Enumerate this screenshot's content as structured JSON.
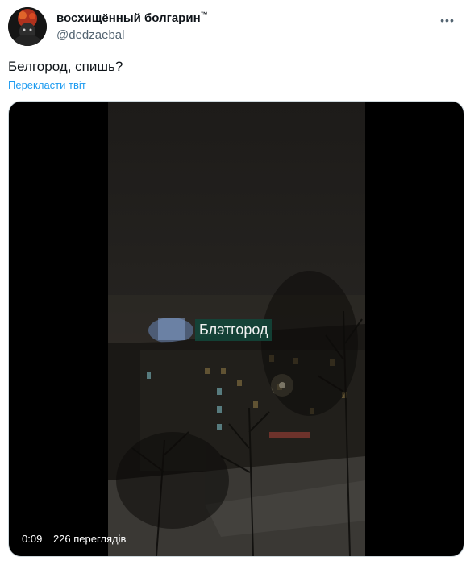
{
  "author": {
    "display_name": "восхищённый болгарин",
    "display_name_mark": "™",
    "handle": "@dedzaebal",
    "avatar_icon": "avatar-portrait-icon"
  },
  "tweet": {
    "text": "Белгород, спишь?",
    "translate_label": "Перекласти твіт"
  },
  "video": {
    "overlay_text": "Блэтгород",
    "duration": "0:09",
    "views": "226 переглядів"
  },
  "colors": {
    "link": "#1d9bf0",
    "text": "#0f1419",
    "secondary": "#536471"
  }
}
